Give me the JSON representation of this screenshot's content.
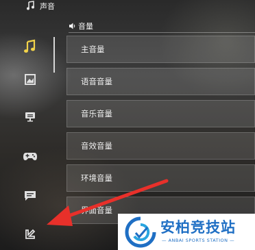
{
  "header": {
    "title": "声音",
    "icon": "music-note-icon"
  },
  "sidebar": {
    "items": [
      {
        "name": "audio",
        "icon": "music-note-icon",
        "active": true
      },
      {
        "name": "display",
        "icon": "image-frame-icon",
        "active": false
      },
      {
        "name": "monitor",
        "icon": "monitor-icon",
        "active": false
      },
      {
        "name": "controller",
        "icon": "gamepad-icon",
        "active": false
      },
      {
        "name": "chat",
        "icon": "chat-bubble-icon",
        "active": false
      },
      {
        "name": "other",
        "icon": "tools-icon",
        "active": false
      }
    ],
    "active_color": "#f2d34a"
  },
  "section": {
    "icon": "speaker-icon",
    "title": "音量"
  },
  "volume_rows": [
    {
      "label": "主音量"
    },
    {
      "label": "语音音量"
    },
    {
      "label": "音乐音量"
    },
    {
      "label": "音效音量"
    },
    {
      "label": "环境音量"
    },
    {
      "label": "界面音量"
    }
  ],
  "annotation": {
    "arrow_color": "#e8302a"
  },
  "watermark": {
    "text": "安柏竞技站",
    "subtext": "— ANBAI SPORTS STATION —",
    "color": "#1f6fc4"
  }
}
